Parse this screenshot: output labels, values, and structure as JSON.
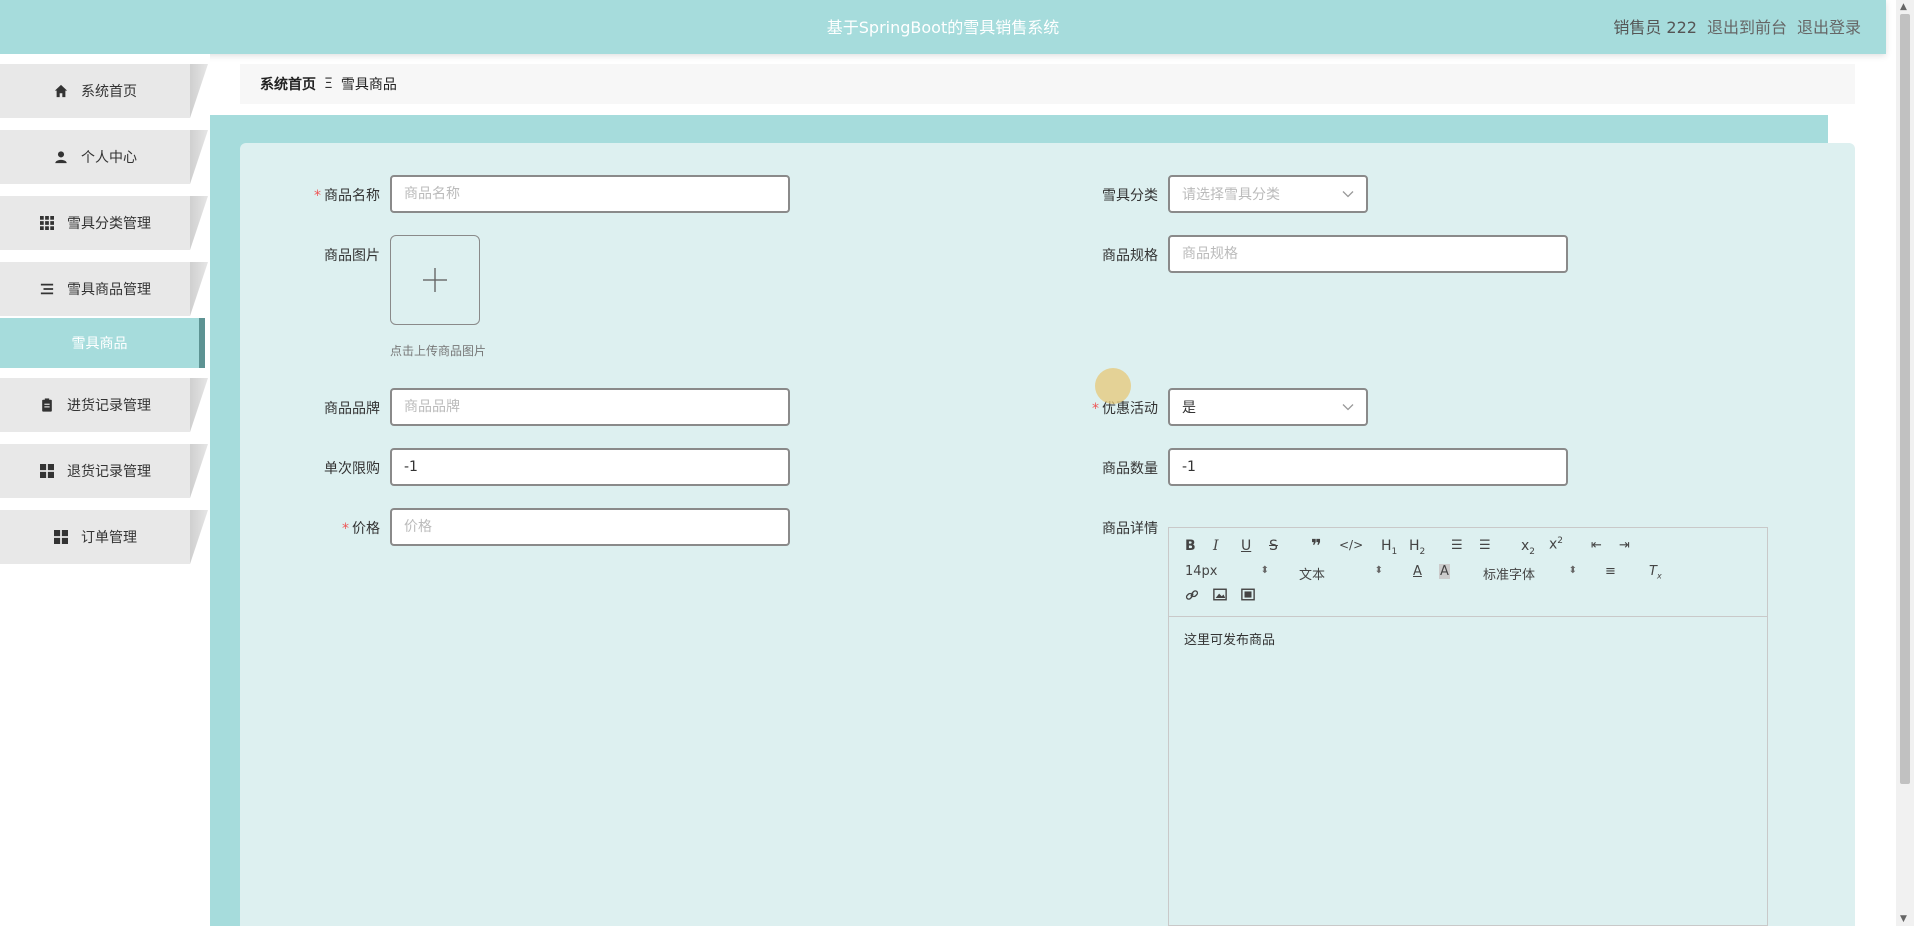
{
  "header": {
    "title": "基于SpringBoot的雪具销售系统",
    "user": "销售员 222",
    "to_front": "退出到前台",
    "logout": "退出登录"
  },
  "sidebar": {
    "items": [
      {
        "label": "系统首页",
        "icon": "home-icon"
      },
      {
        "label": "个人中心",
        "icon": "user-icon"
      },
      {
        "label": "雪具分类管理",
        "icon": "grid-icon"
      },
      {
        "label": "雪具商品管理",
        "icon": "list-icon"
      },
      {
        "label": "进货记录管理",
        "icon": "clipboard-icon"
      },
      {
        "label": "退货记录管理",
        "icon": "apps-icon"
      },
      {
        "label": "订单管理",
        "icon": "apps-icon"
      }
    ],
    "active_sub": "雪具商品"
  },
  "breadcrumb": {
    "home": "系统首页",
    "sep": "Ξ",
    "current": "雪具商品"
  },
  "form": {
    "name_label": "商品名称",
    "name_placeholder": "商品名称",
    "category_label": "雪具分类",
    "category_placeholder": "请选择雪具分类",
    "image_label": "商品图片",
    "upload_hint": "点击上传商品图片",
    "spec_label": "商品规格",
    "spec_placeholder": "商品规格",
    "brand_label": "商品品牌",
    "brand_placeholder": "商品品牌",
    "promo_label": "优惠活动",
    "promo_value": "是",
    "limit_label": "单次限购",
    "limit_value": "-1",
    "qty_label": "商品数量",
    "qty_value": "-1",
    "price_label": "价格",
    "price_placeholder": "价格",
    "detail_label": "商品详情"
  },
  "editor": {
    "size": "14px",
    "text_type": "文本",
    "font": "标准字体",
    "content": "这里可发布商品"
  }
}
